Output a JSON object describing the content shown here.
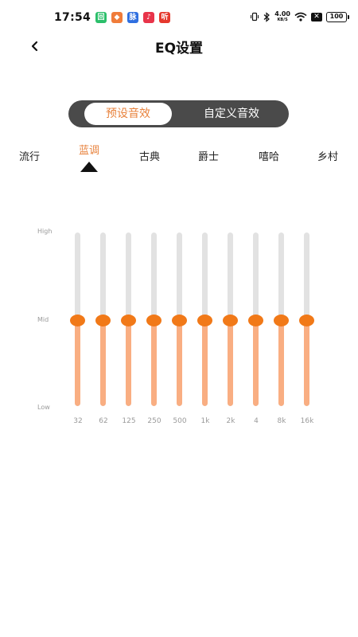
{
  "status_bar": {
    "time": "17:54",
    "net_speed": "4.00",
    "net_unit": "KB/S",
    "battery": "100",
    "x_badge": "✕",
    "app_icons": [
      {
        "glyph": "回",
        "color": "#2bbf6a"
      },
      {
        "glyph": "◆",
        "color": "#f07c3a"
      },
      {
        "glyph": "脉",
        "color": "#2f6fe0"
      },
      {
        "glyph": "♪",
        "color": "#e8344a"
      },
      {
        "glyph": "听",
        "color": "#e5392d"
      }
    ]
  },
  "header": {
    "title": "EQ设置",
    "back_icon": "chevron-left-icon"
  },
  "mode_toggle": {
    "preset_label": "预设音效",
    "custom_label": "自定义音效",
    "active": "preset"
  },
  "genres": {
    "items": [
      "流行",
      "蓝调",
      "古典",
      "爵士",
      "嘻哈",
      "乡村"
    ],
    "active_index": 1
  },
  "eq": {
    "high_label": "High",
    "mid_label": "Mid",
    "low_label": "Low",
    "bands": [
      {
        "freq": "32",
        "level": 0.5
      },
      {
        "freq": "62",
        "level": 0.5
      },
      {
        "freq": "125",
        "level": 0.5
      },
      {
        "freq": "250",
        "level": 0.5
      },
      {
        "freq": "500",
        "level": 0.5
      },
      {
        "freq": "1k",
        "level": 0.5
      },
      {
        "freq": "2k",
        "level": 0.5
      },
      {
        "freq": "4",
        "level": 0.5
      },
      {
        "freq": "8k",
        "level": 0.5
      },
      {
        "freq": "16k",
        "level": 0.5
      }
    ]
  },
  "colors": {
    "accent": "#e8823c",
    "knob": "#f17918",
    "fill": "#f9ae82",
    "track": "#e2e2e2",
    "toggle_bg": "#4a4a4a"
  }
}
